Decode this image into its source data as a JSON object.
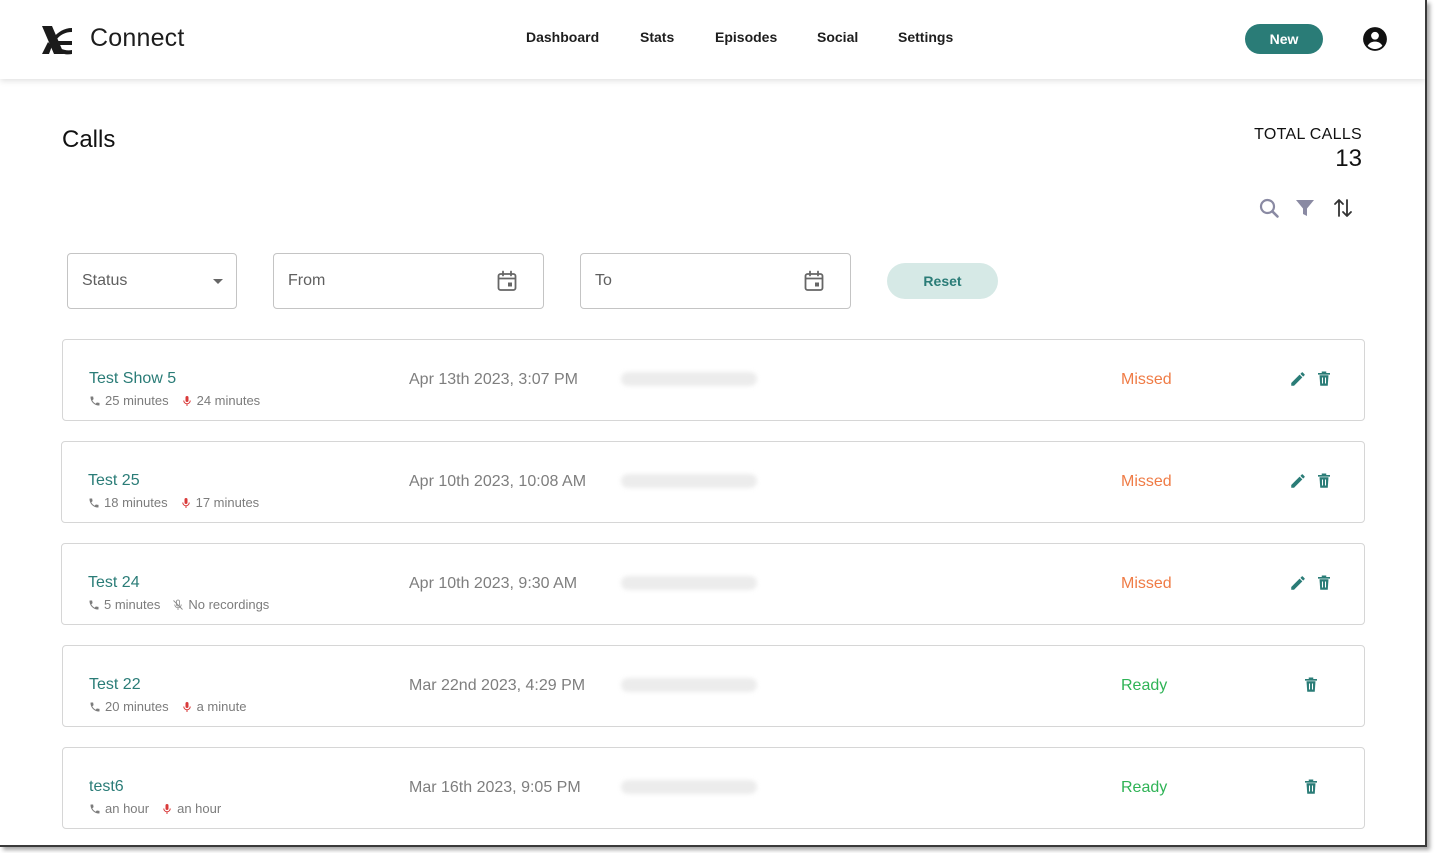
{
  "app": {
    "brand": "Connect"
  },
  "nav": {
    "items": [
      {
        "label": "Dashboard"
      },
      {
        "label": "Stats"
      },
      {
        "label": "Episodes"
      },
      {
        "label": "Social"
      },
      {
        "label": "Settings"
      }
    ],
    "new_label": "New"
  },
  "page": {
    "title": "Calls",
    "total_label": "TOTAL CALLS",
    "total_value": "13"
  },
  "filters": {
    "status_placeholder": "Status",
    "from_placeholder": "From",
    "to_placeholder": "To",
    "reset_label": "Reset"
  },
  "calls": [
    {
      "name": "Test Show 5",
      "call_duration": "25 minutes",
      "recording": "24 minutes",
      "date": "Apr 13th 2023, 3:07 PM",
      "status": "Missed"
    },
    {
      "name": "Test 25",
      "call_duration": "18 minutes",
      "recording": "17 minutes",
      "date": "Apr 10th 2023, 10:08 AM",
      "status": "Missed"
    },
    {
      "name": "Test 24",
      "call_duration": "5 minutes",
      "recording": "No recordings",
      "date": "Apr 10th 2023, 9:30 AM",
      "status": "Missed"
    },
    {
      "name": "Test 22",
      "call_duration": "20 minutes",
      "recording": "a minute",
      "date": "Mar 22nd 2023, 4:29 PM",
      "status": "Ready"
    },
    {
      "name": "test6",
      "call_duration": "an hour",
      "recording": "an hour",
      "date": "Mar 16th 2023, 9:05 PM",
      "status": "Ready"
    }
  ],
  "colors": {
    "accent": "#2a7c77",
    "missed": "#ef7b45",
    "ready": "#2fb356",
    "mic": "#d93a3a"
  },
  "icons": [
    "logo-icon",
    "user-account-icon",
    "search-icon",
    "filter-icon",
    "sort-icon",
    "chevron-down-icon",
    "calendar-icon",
    "phone-icon",
    "mic-icon",
    "mic-off-icon",
    "edit-icon",
    "delete-icon"
  ]
}
